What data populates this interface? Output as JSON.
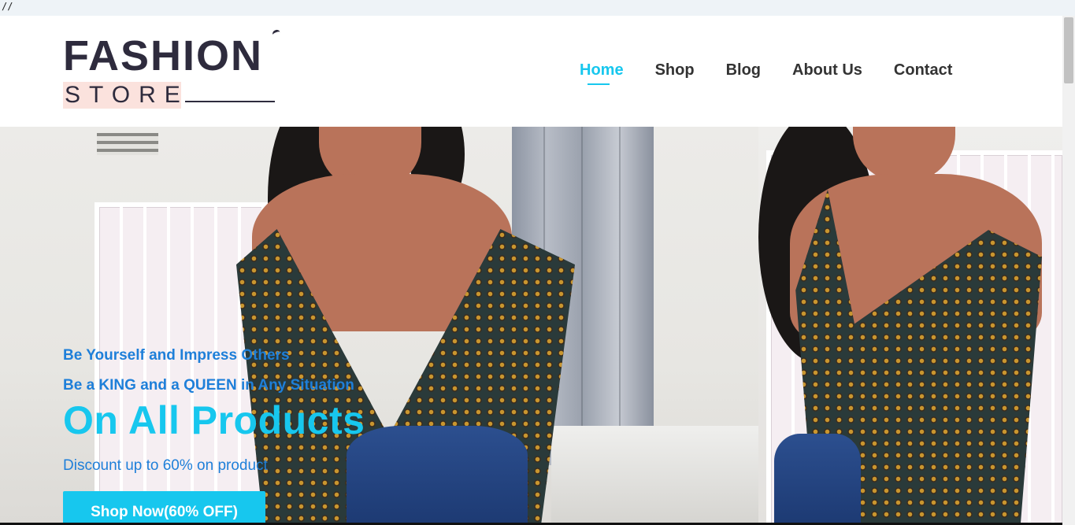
{
  "top_strip": {
    "text": "//"
  },
  "logo": {
    "word": "FASHION",
    "sub": "STORE"
  },
  "nav": {
    "items": [
      {
        "label": "Home",
        "active": true
      },
      {
        "label": "Shop",
        "active": false
      },
      {
        "label": "Blog",
        "active": false
      },
      {
        "label": "About Us",
        "active": false
      },
      {
        "label": "Contact",
        "active": false
      }
    ]
  },
  "hero": {
    "tagline_1": "Be Yourself and Impress Others",
    "tagline_2": "Be a KING and a QUEEN in Any Situation",
    "headline": "On All Products",
    "discount": "Discount up to 60% on product",
    "cta_label": "Shop Now(60% OFF)"
  },
  "colors": {
    "accent": "#17c7ee",
    "text_blue": "#1e7fd9",
    "nav_text": "#333333",
    "logo_dark": "#2e2b3d",
    "logo_pink": "#fbe2dd"
  }
}
